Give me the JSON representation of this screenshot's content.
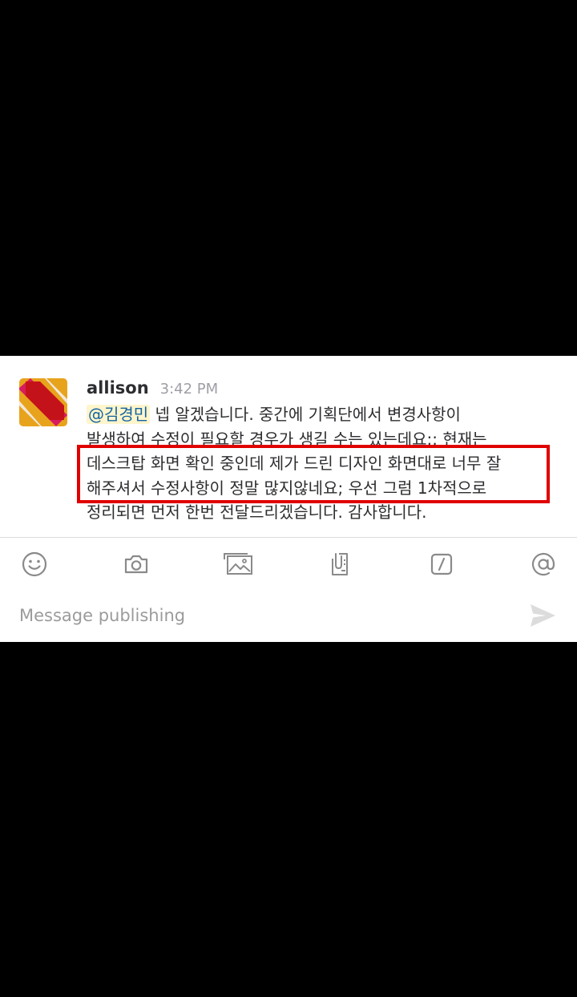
{
  "message": {
    "author": "allison",
    "timestamp": "3:42 PM",
    "mention": "@김경민",
    "line1_rest": " 넵 알겠습니다. 중간에 기획단에서 변경사항이",
    "line2": "발생하여 수정이 필요할 경우가 생길 수는 있는데요;; 현재는",
    "line3": "데스크탑 화면 확인 중인데 제가 드린 디자인 화면대로 너무 잘",
    "line4": "해주셔서 수정사항이 정말 많지않네요; 우선 그럼 1차적으로",
    "line5": "정리되면 먼저 한번 전달드리겠습니다. 감사합니다."
  },
  "toolbar": {
    "icons": [
      "emoji-icon",
      "camera-icon",
      "photo-icon",
      "file-icon",
      "slash-command-icon",
      "mention-icon"
    ]
  },
  "composer": {
    "placeholder": "Message publishing"
  },
  "colors": {
    "mention_text": "#1264a3",
    "mention_bg": "#fff5cc",
    "highlight_border": "#e00000",
    "icon_gray": "#8a8a8a"
  }
}
